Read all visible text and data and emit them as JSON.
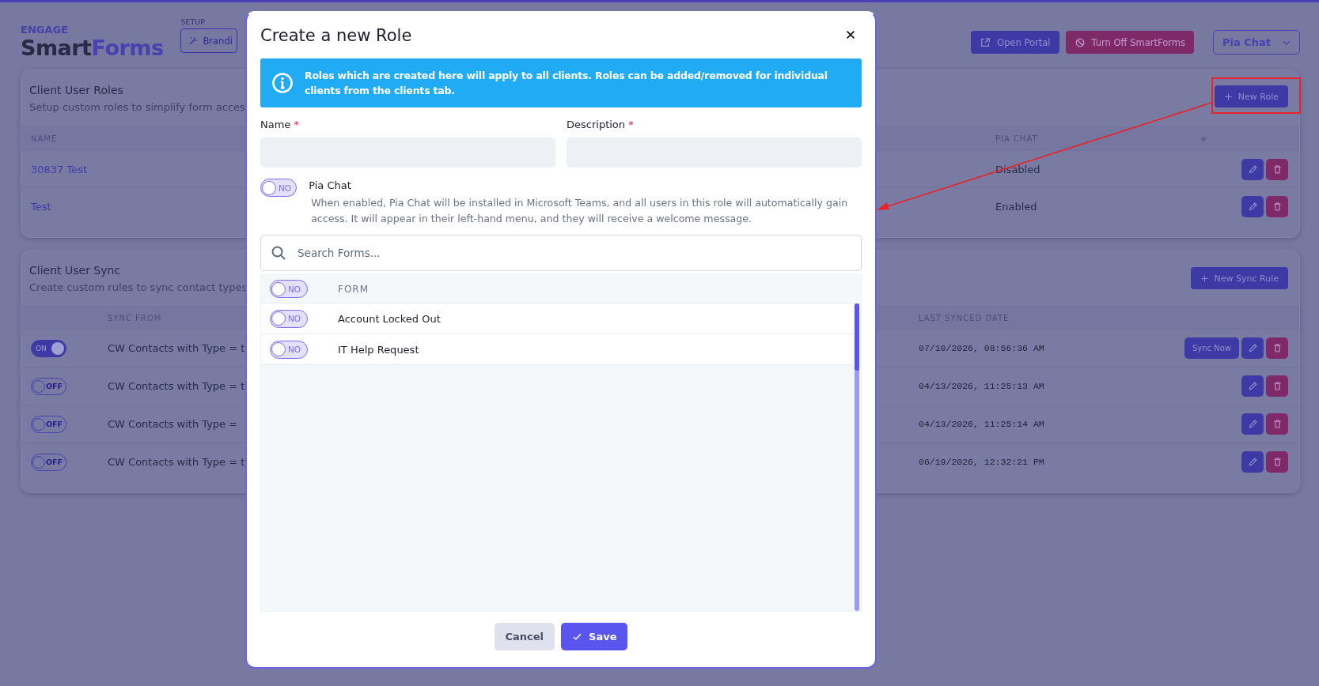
{
  "header": {
    "brand_top": "ENGAGE",
    "brand_main": "Smart",
    "brand_accent": "Forms",
    "setup_label": "SETUP",
    "setup_button": "Brandi",
    "buttons": [
      {
        "label": "Open Portal",
        "kind": "primary"
      },
      {
        "label": "Turn Off SmartForms",
        "kind": "danger"
      }
    ],
    "user_menu": "Pia Chat"
  },
  "roles_card": {
    "title": "Client User Roles",
    "subtitle": "Setup custom roles to simplify form acces",
    "new_button": "New Role",
    "columns": [
      "NAME",
      "PIA CHAT"
    ],
    "rows": [
      {
        "name": "30837 Test",
        "pia_chat": "Disabled"
      },
      {
        "name": "Test",
        "pia_chat": "Enabled"
      }
    ]
  },
  "sync_card": {
    "title": "Client User Sync",
    "subtitle": "Create custom rules to sync contact types",
    "new_button": "New Sync Rule",
    "columns": [
      "SYNC FROM",
      "LAST SYNCED DATE"
    ],
    "rows": [
      {
        "on": true,
        "toggle_label": "ON",
        "sync_from": "CW Contacts with Type = t",
        "last_synced": "07/10/2026, 08:56:36 AM",
        "sync_now": "Sync Now"
      },
      {
        "on": false,
        "toggle_label": "OFF",
        "sync_from": "CW Contacts with Type = t",
        "last_synced": "04/13/2026, 11:25:13 AM"
      },
      {
        "on": false,
        "toggle_label": "OFF",
        "sync_from": "CW Contacts with Type =",
        "last_synced": "04/13/2026, 11:25:14 AM"
      },
      {
        "on": false,
        "toggle_label": "OFF",
        "sync_from": "CW Contacts with Type = t",
        "last_synced": "06/19/2026, 12:32:21 PM"
      }
    ]
  },
  "modal": {
    "title": "Create a new Role",
    "info": "Roles which are created here will apply to all clients. Roles can be added/removed for individual clients from the clients tab.",
    "fields": [
      {
        "label": "Name",
        "required_mark": "*"
      },
      {
        "label": "Description",
        "required_mark": "*"
      }
    ],
    "pia_chat": {
      "on": false,
      "toggle_label": "NO",
      "label": "Pia Chat",
      "description": "When enabled, Pia Chat will be installed in Microsoft Teams, and all users in this role will automatically gain access. It will appear in their left-hand menu, and they will receive a welcome message."
    },
    "search": {
      "placeholder": "Search Forms..."
    },
    "forms_table": {
      "header": {
        "on": false,
        "toggle_label": "NO",
        "label": "FORM"
      },
      "rows": [
        {
          "on": false,
          "toggle_label": "NO",
          "name": "Account Locked Out"
        },
        {
          "on": false,
          "toggle_label": "NO",
          "name": "IT Help Request"
        }
      ]
    },
    "buttons": [
      {
        "label": "Cancel",
        "kind": "secondary"
      },
      {
        "label": "Save",
        "kind": "primary"
      }
    ]
  }
}
